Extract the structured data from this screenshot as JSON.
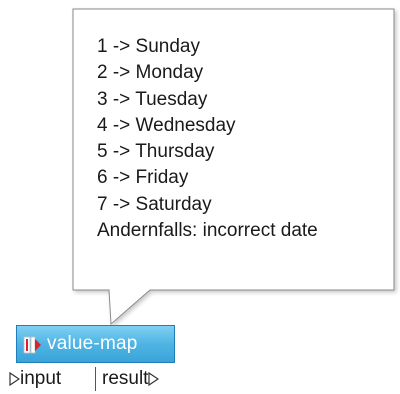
{
  "tooltip": {
    "lines": [
      "1 -> Sunday",
      "2 -> Monday",
      "3 -> Tuesday",
      "4 -> Wednesday",
      "5 -> Thursday",
      "6 -> Friday",
      "7 -> Saturday",
      "Andernfalls: incorrect date"
    ]
  },
  "component": {
    "title": "value-map",
    "icon": "value-map-icon",
    "input_label": "input",
    "output_label": "result"
  },
  "colors": {
    "header_top": "#7fd0f2",
    "header_bottom": "#3aa3d8",
    "icon_accent": "#d9232e"
  }
}
